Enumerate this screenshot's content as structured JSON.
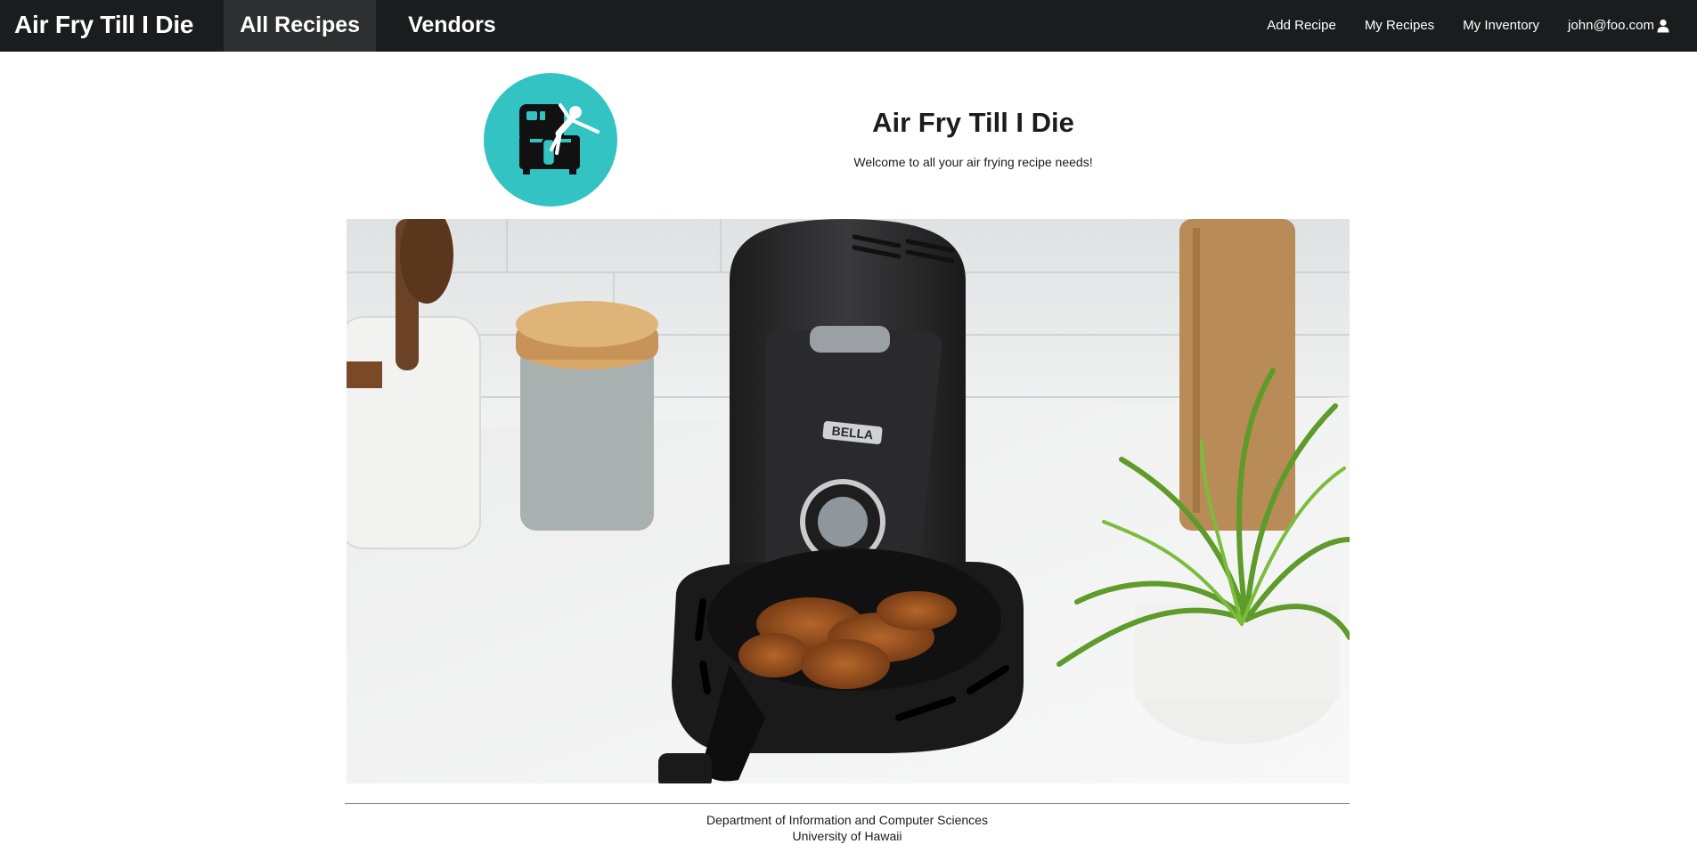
{
  "navbar": {
    "brand": "Air Fry Till I Die",
    "items": [
      {
        "label": "All Recipes",
        "active": true
      },
      {
        "label": "Vendors",
        "active": false
      }
    ],
    "right_items": [
      {
        "label": "Add Recipe"
      },
      {
        "label": "My Recipes"
      },
      {
        "label": "My Inventory"
      },
      {
        "label": "john@foo.com",
        "icon": "user-icon"
      }
    ]
  },
  "header": {
    "logo_icon": "air-fryer-logo-icon",
    "logo_color": "#34c3c3",
    "title": "Air Fry Till I Die",
    "subtitle": "Welcome to all your air frying recipe needs!"
  },
  "hero": {
    "image": "air-fryer-photo",
    "brand_label": "BELLA"
  },
  "footer": {
    "line1": "Department of Information and Computer Sciences",
    "line2": "University of Hawaii"
  }
}
